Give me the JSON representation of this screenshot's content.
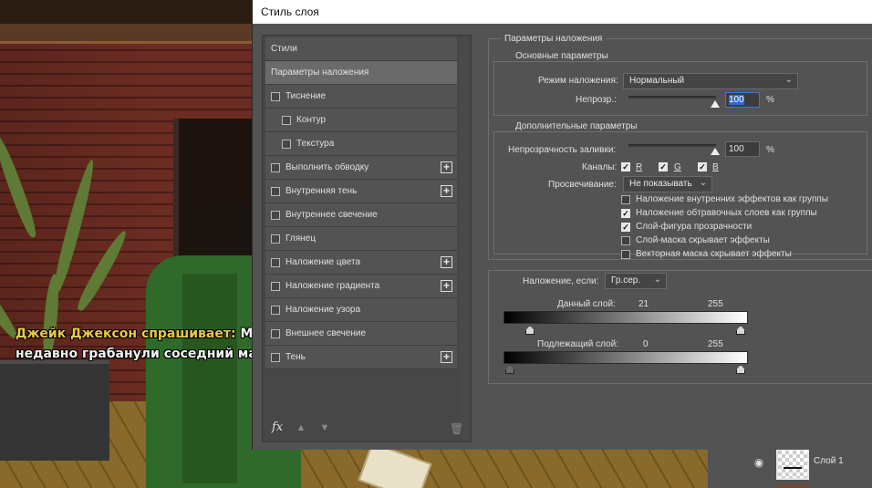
{
  "game": {
    "speaker": "Джейк Джексон спрашивает:",
    "line1_rest": "Мне",
    "line2": "недавно грабанули соседний магаз"
  },
  "dialog": {
    "title": "Стиль слоя",
    "styles_list": {
      "header": "Стили",
      "selected": "Параметры наложения",
      "items": [
        {
          "label": "Тиснение",
          "indent": false,
          "checked": false,
          "plus": false
        },
        {
          "label": "Контур",
          "indent": true,
          "checked": false,
          "plus": false
        },
        {
          "label": "Текстура",
          "indent": true,
          "checked": false,
          "plus": false
        },
        {
          "label": "Выполнить обводку",
          "indent": false,
          "checked": false,
          "plus": true
        },
        {
          "label": "Внутренняя тень",
          "indent": false,
          "checked": false,
          "plus": true
        },
        {
          "label": "Внутреннее свечение",
          "indent": false,
          "checked": false,
          "plus": false
        },
        {
          "label": "Глянец",
          "indent": false,
          "checked": false,
          "plus": false
        },
        {
          "label": "Наложение цвета",
          "indent": false,
          "checked": false,
          "plus": true
        },
        {
          "label": "Наложение градиента",
          "indent": false,
          "checked": false,
          "plus": true
        },
        {
          "label": "Наложение узора",
          "indent": false,
          "checked": false,
          "plus": false
        },
        {
          "label": "Внешнее свечение",
          "indent": false,
          "checked": false,
          "plus": false
        },
        {
          "label": "Тень",
          "indent": false,
          "checked": false,
          "plus": true
        }
      ],
      "fx_label": "fx"
    },
    "blending": {
      "section_title": "Параметры наложения",
      "general": {
        "title": "Основные параметры",
        "mode_label": "Режим наложения:",
        "mode_value": "Нормальный",
        "opacity_label": "Непрозр.:",
        "opacity_value": "100",
        "opacity_unit": "%"
      },
      "advanced": {
        "title": "Дополнительные параметры",
        "fill_label": "Непрозрачность заливки:",
        "fill_value": "100",
        "fill_unit": "%",
        "channels_label": "Каналы:",
        "channels": [
          {
            "label": "R",
            "checked": true
          },
          {
            "label": "G",
            "checked": true
          },
          {
            "label": "B",
            "checked": true
          }
        ],
        "knockout_label": "Просвечивание:",
        "knockout_value": "Не показывать",
        "options": [
          {
            "label": "Наложение внутренних эффектов как группы",
            "checked": false
          },
          {
            "label": "Наложение обтравочных слоев как группы",
            "checked": true
          },
          {
            "label": "Слой-фигура прозрачности",
            "checked": true
          },
          {
            "label": "Слой-маска скрывает эффекты",
            "checked": false
          },
          {
            "label": "Векторная маска скрывает эффекты",
            "checked": false
          }
        ]
      },
      "blend_if": {
        "label": "Наложение, если:",
        "value": "Гр.сер.",
        "this_layer_label": "Данный слой:",
        "this_layer_low": "21",
        "this_layer_high": "255",
        "underlying_label": "Подлежащий слой:",
        "underlying_low": "0",
        "underlying_high": "255"
      }
    }
  },
  "layers_peek": {
    "layer_name": "Слой 1"
  }
}
